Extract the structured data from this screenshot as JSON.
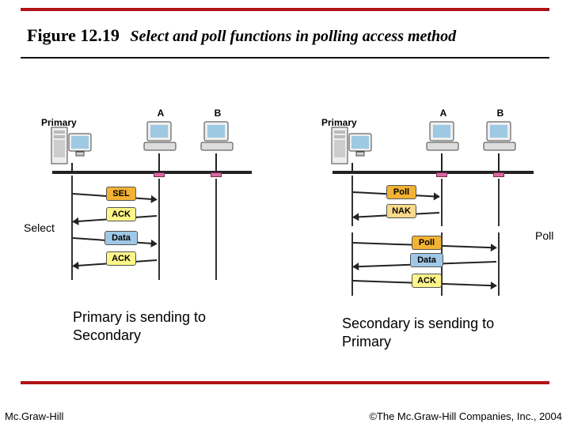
{
  "figure": {
    "number": "Figure 12.19",
    "caption": "Select and poll functions in polling access method"
  },
  "footer": {
    "left": "Mc.Graw-Hill",
    "right": "©The Mc.Graw-Hill Companies, Inc., 2004"
  },
  "captions": {
    "left": "Primary is sending to Secondary",
    "right": "Secondary is sending to Primary"
  },
  "labels": {
    "primary": "Primary",
    "stationA": "A",
    "stationB": "B",
    "select": "Select",
    "poll": "Poll"
  },
  "messages": {
    "sel": "SEL",
    "ack": "ACK",
    "data": "Data",
    "poll": "Poll",
    "nak": "NAK"
  }
}
